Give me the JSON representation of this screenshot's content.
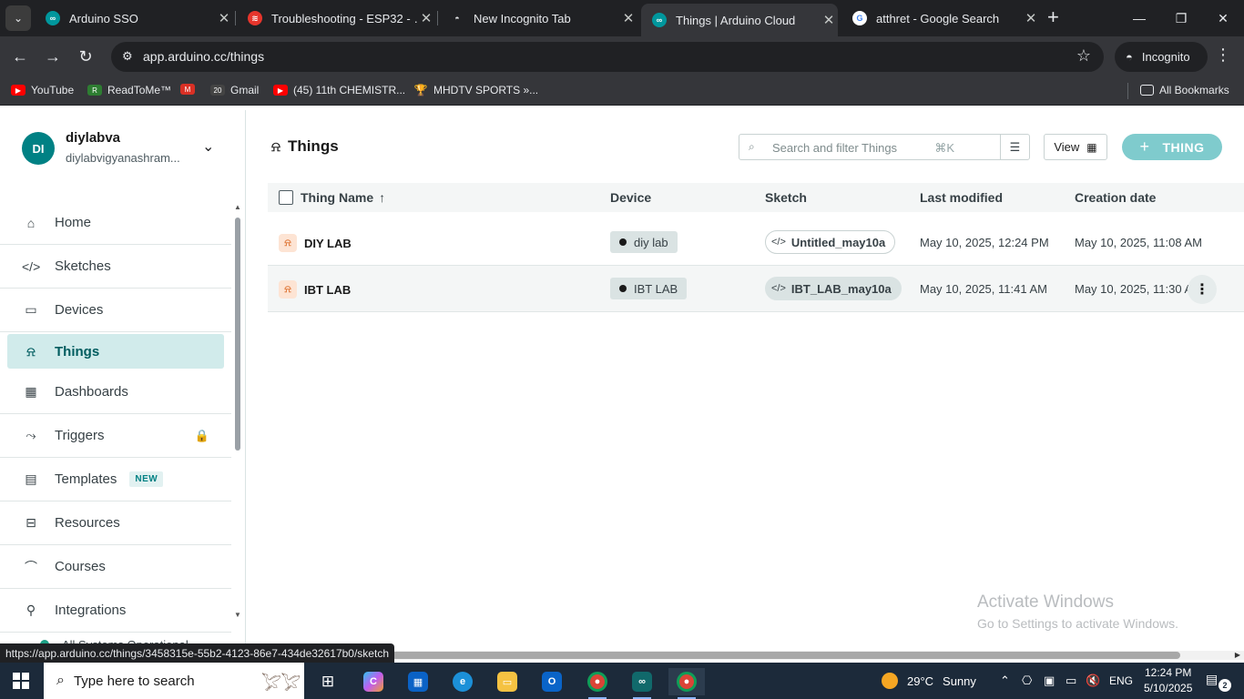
{
  "browser": {
    "tabs": [
      {
        "title": "Arduino SSO",
        "favicon": "arduino-icon",
        "active": false
      },
      {
        "title": "Troubleshooting - ESP32 - …",
        "favicon": "espressif-icon",
        "active": false
      },
      {
        "title": "New Incognito Tab",
        "favicon": "incognito-icon",
        "active": false
      },
      {
        "title": "Things | Arduino Cloud",
        "favicon": "arduino-icon",
        "active": true
      },
      {
        "title": "atthret - Google Search",
        "favicon": "google-icon",
        "active": false
      }
    ],
    "address": "app.arduino.cc/things",
    "incognito_label": "Incognito",
    "bookmarks": [
      {
        "label": "YouTube",
        "icon": "youtube-icon"
      },
      {
        "label": "ReadToMe™",
        "icon": "readtome-icon"
      },
      {
        "label": "",
        "icon": "gmail-icon"
      },
      {
        "label": "Gmail",
        "icon": "calendar-icon"
      },
      {
        "label": "(45) 11th CHEMISTR...",
        "icon": "youtube-icon"
      },
      {
        "label": "MHDTV SPORTS »...",
        "icon": "trophy-icon"
      }
    ],
    "all_bookmarks_label": "All Bookmarks",
    "hover_url": "https://app.arduino.cc/things/3458315e-55b2-4123-86e7-434de32617b0/sketch"
  },
  "sidebar": {
    "avatar_initials": "DI",
    "account_name": "diylabva",
    "account_email": "diylabvigyanashram...",
    "items": [
      {
        "label": "Home",
        "icon": "home-icon"
      },
      {
        "label": "Sketches",
        "icon": "code-icon"
      },
      {
        "label": "Devices",
        "icon": "device-icon"
      },
      {
        "label": "Things",
        "icon": "thing-icon",
        "active": true
      },
      {
        "label": "Dashboards",
        "icon": "dashboard-icon"
      },
      {
        "label": "Triggers",
        "icon": "trigger-icon",
        "locked": true
      },
      {
        "label": "Templates",
        "icon": "template-icon",
        "badge": "NEW"
      },
      {
        "label": "Resources",
        "icon": "book-icon"
      },
      {
        "label": "Courses",
        "icon": "graduation-cap-icon"
      },
      {
        "label": "Integrations",
        "icon": "integrations-icon"
      }
    ],
    "status_text": "All Systems Operational"
  },
  "main": {
    "title": "Things",
    "search_placeholder": "Search and filter Things",
    "search_shortcut": "⌘K",
    "view_label": "View",
    "add_label": "THING",
    "columns": [
      "Thing Name",
      "Device",
      "Sketch",
      "Last modified",
      "Creation date"
    ],
    "rows": [
      {
        "name": "DIY LAB",
        "device": "diy lab",
        "sketch": "Untitled_may10a",
        "last_modified": "May 10, 2025, 12:24 PM",
        "created": "May 10, 2025, 11:08 AM"
      },
      {
        "name": "IBT LAB",
        "device": "IBT LAB",
        "sketch": "IBT_LAB_may10a",
        "last_modified": "May 10, 2025, 11:41 AM",
        "created": "May 10, 2025, 11:30 A"
      }
    ]
  },
  "watermark": {
    "line1": "Activate Windows",
    "line2": "Go to Settings to activate Windows."
  },
  "taskbar": {
    "search_placeholder": "Type here to search",
    "temperature": "29°C",
    "weather": "Sunny",
    "language": "ENG",
    "time": "12:24 PM",
    "date": "5/10/2025",
    "notifications": "2"
  }
}
